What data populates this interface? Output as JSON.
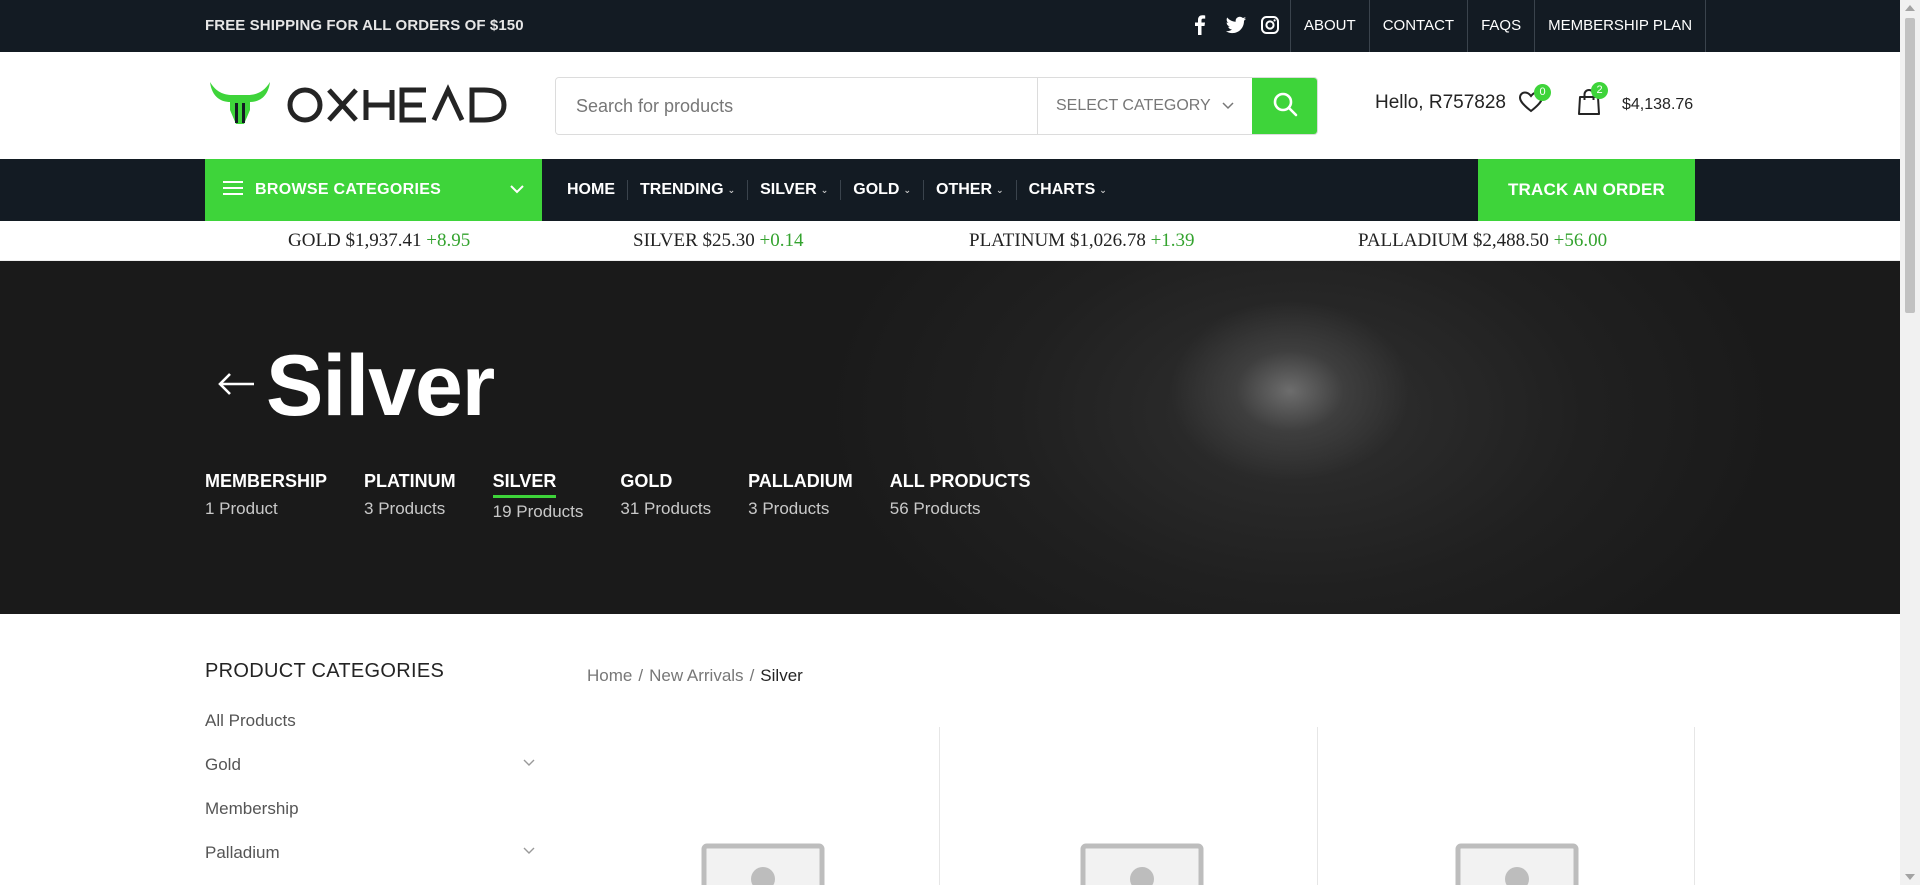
{
  "topbar": {
    "promo": "FREE SHIPPING FOR ALL ORDERS OF $150",
    "social_icons": [
      "facebook-icon",
      "twitter-icon",
      "instagram-icon"
    ],
    "links": [
      "ABOUT",
      "CONTACT",
      "FAQS",
      "MEMBERSHIP PLAN"
    ]
  },
  "header": {
    "logo_text": "OXHEAD",
    "search_placeholder": "Search for products",
    "category_select": "SELECT CATEGORY",
    "greeting": "Hello, R757828",
    "wishlist_count": "0",
    "cart_count": "2",
    "cart_total": "$4,138.76"
  },
  "nav": {
    "browse_label": "BROWSE CATEGORIES",
    "items": [
      {
        "label": "HOME",
        "has_dropdown": false
      },
      {
        "label": "TRENDING",
        "has_dropdown": true
      },
      {
        "label": "SILVER",
        "has_dropdown": true
      },
      {
        "label": "GOLD",
        "has_dropdown": true
      },
      {
        "label": "OTHER",
        "has_dropdown": true
      },
      {
        "label": "CHARTS",
        "has_dropdown": true
      }
    ],
    "track_label": "TRACK AN ORDER"
  },
  "ticker": [
    {
      "metal": "GOLD",
      "price": "$1,937.41",
      "change": "+8.95"
    },
    {
      "metal": "SILVER",
      "price": "$25.30",
      "change": "+0.14"
    },
    {
      "metal": "PLATINUM",
      "price": "$1,026.78",
      "change": "+1.39"
    },
    {
      "metal": "PALLADIUM",
      "price": "$2,488.50",
      "change": "+56.00"
    }
  ],
  "hero": {
    "title": "Silver",
    "subcategories": [
      {
        "name": "MEMBERSHIP",
        "count": "1 Product",
        "active": false
      },
      {
        "name": "PLATINUM",
        "count": "3 Products",
        "active": false
      },
      {
        "name": "SILVER",
        "count": "19 Products",
        "active": true
      },
      {
        "name": "GOLD",
        "count": "31 Products",
        "active": false
      },
      {
        "name": "PALLADIUM",
        "count": "3 Products",
        "active": false
      },
      {
        "name": "ALL PRODUCTS",
        "count": "56 Products",
        "active": false
      }
    ]
  },
  "sidebar": {
    "title": "PRODUCT CATEGORIES",
    "items": [
      {
        "label": "All Products",
        "expandable": false
      },
      {
        "label": "Gold",
        "expandable": true
      },
      {
        "label": "Membership",
        "expandable": false
      },
      {
        "label": "Palladium",
        "expandable": true
      }
    ]
  },
  "breadcrumb": {
    "items": [
      "Home",
      "New Arrivals"
    ],
    "current": "Silver"
  },
  "colors": {
    "accent": "#3ed43a",
    "dark": "#131b23",
    "ticker_change": "#34a32f"
  }
}
